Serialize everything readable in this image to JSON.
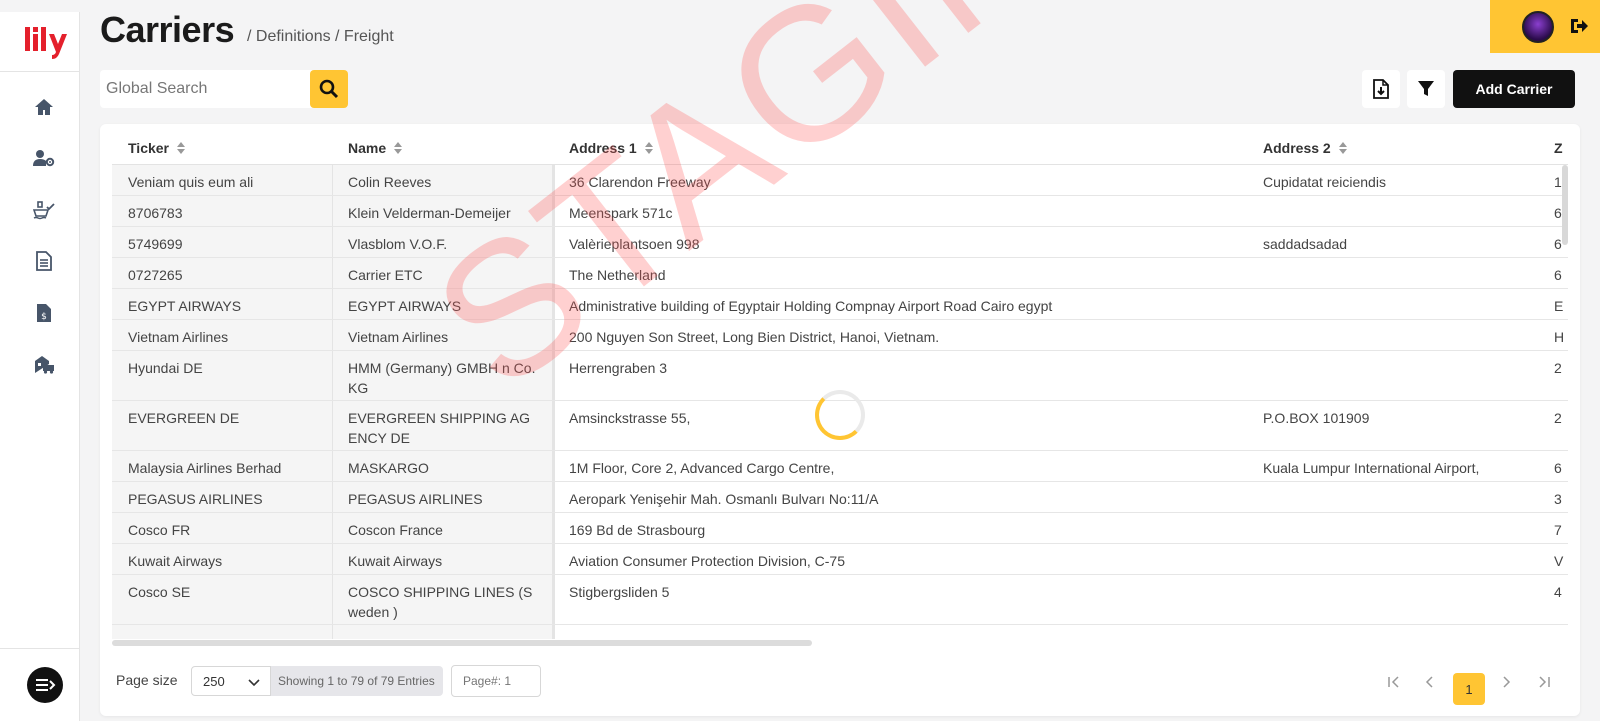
{
  "header": {
    "title": "Carriers",
    "breadcrumb": "/ Definitions / Freight"
  },
  "brand": {
    "logo_text": "lily",
    "accent": "#ffc533",
    "logo_color": "#e4202c"
  },
  "sidebar": {
    "items": [
      {
        "icon": "home-icon"
      },
      {
        "icon": "user-settings-icon"
      },
      {
        "icon": "ship-check-icon"
      },
      {
        "icon": "document-icon"
      },
      {
        "icon": "invoice-dollar-icon"
      },
      {
        "icon": "building-truck-icon"
      }
    ],
    "menu_icon": "menu-icon"
  },
  "toolbar": {
    "search_placeholder": "Global Search",
    "add_label": "Add Carrier"
  },
  "table": {
    "columns": [
      "Ticker",
      "Name",
      "Address 1",
      "Address 2",
      "Z"
    ],
    "rows": [
      {
        "ticker": "Veniam quis eum ali",
        "name": "Colin Reeves",
        "address1": "36 Clarendon Freeway",
        "address2": "Cupidatat reiciendis",
        "next": "1"
      },
      {
        "ticker": "8706783",
        "name": "Klein Velderman-Demeijer",
        "address1": "Meenspark 571c",
        "address2": "",
        "next": "6"
      },
      {
        "ticker": "5749699",
        "name": "Vlasblom V.O.F.",
        "address1": "Valèrieplantsoen 998",
        "address2": "saddadsadad",
        "next": "6"
      },
      {
        "ticker": "0727265",
        "name": "Carrier ETC",
        "address1": "The Netherland",
        "address2": "",
        "next": "6"
      },
      {
        "ticker": "EGYPT AIRWAYS",
        "name": "EGYPT AIRWAYS",
        "address1": "Administrative building of Egyptair Holding Compnay Airport Road Cairo egypt",
        "address2": "",
        "next": "E"
      },
      {
        "ticker": "Vietnam Airlines",
        "name": "Vietnam Airlines",
        "address1": "200 Nguyen Son Street, Long Bien District, Hanoi, Vietnam.",
        "address2": "",
        "next": "H"
      },
      {
        "ticker": "Hyundai DE",
        "name": "HMM (Germany) GMBH n Co. KG",
        "address1": "Herrengraben 3",
        "address2": "",
        "next": "2"
      },
      {
        "ticker": "EVERGREEN DE",
        "name": "EVERGREEN SHIPPING AGENCY DE",
        "address1": "Amsinckstrasse 55,",
        "address2": "P.O.BOX 101909",
        "next": "2"
      },
      {
        "ticker": "Malaysia Airlines Berhad",
        "name": "MASKARGO",
        "address1": "1M Floor, Core 2, Advanced Cargo Centre,",
        "address2": "Kuala Lumpur International Airport,",
        "next": "6"
      },
      {
        "ticker": "PEGASUS AIRLINES",
        "name": "PEGASUS AIRLINES",
        "address1": "Aeropark Yenişehir Mah. Osmanlı Bulvarı No:11/A",
        "address2": "",
        "next": "3"
      },
      {
        "ticker": "Cosco FR",
        "name": "Coscon France",
        "address1": "169 Bd de Strasbourg",
        "address2": "",
        "next": "7"
      },
      {
        "ticker": "Kuwait Airways",
        "name": "Kuwait Airways",
        "address1": "Aviation Consumer Protection Division, C-75",
        "address2": "",
        "next": "V"
      },
      {
        "ticker": "Cosco SE",
        "name": "COSCO SHIPPING LINES (Sweden )",
        "address1": "Stigbergsliden 5",
        "address2": "",
        "next": "4"
      }
    ]
  },
  "footer": {
    "page_size_label": "Page size",
    "page_size_value": "250",
    "entries_text": "Showing 1 to 79 of 79 Entries",
    "page_input_placeholder": "Page#: 1",
    "current_page": "1"
  },
  "watermark": "STAGING"
}
